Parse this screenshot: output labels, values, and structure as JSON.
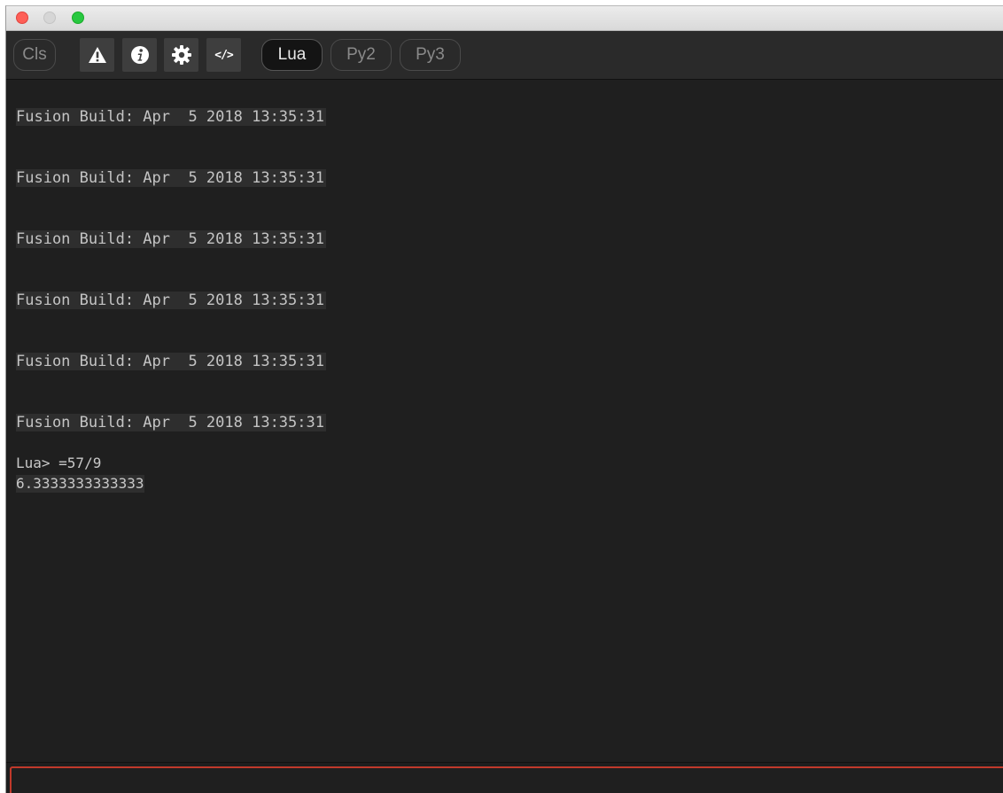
{
  "window": {
    "controls": [
      "close",
      "minimize",
      "maximize"
    ]
  },
  "toolbar": {
    "clear_label": "Cls",
    "icons": {
      "warning": "warning-icon",
      "info": "info-icon",
      "settings": "gear-icon",
      "code": "code-icon",
      "code_glyph": "</>"
    },
    "languages": [
      {
        "label": "Lua",
        "selected": true
      },
      {
        "label": "Py2",
        "selected": false
      },
      {
        "label": "Py3",
        "selected": false
      }
    ]
  },
  "console": {
    "build_lines": [
      "Fusion Build: Apr  5 2018 13:35:31",
      "Fusion Build: Apr  5 2018 13:35:31",
      "Fusion Build: Apr  5 2018 13:35:31",
      "Fusion Build: Apr  5 2018 13:35:31",
      "Fusion Build: Apr  5 2018 13:35:31",
      "Fusion Build: Apr  5 2018 13:35:31"
    ],
    "prompt": "Lua> =57/9",
    "result": "6.3333333333333"
  },
  "input": {
    "value": "",
    "placeholder": ""
  },
  "colors": {
    "background": "#1f1f1f",
    "toolbar": "#2a2a2a",
    "input_border": "#c0392b",
    "close": "#fe5f57",
    "maximize": "#28c840"
  }
}
